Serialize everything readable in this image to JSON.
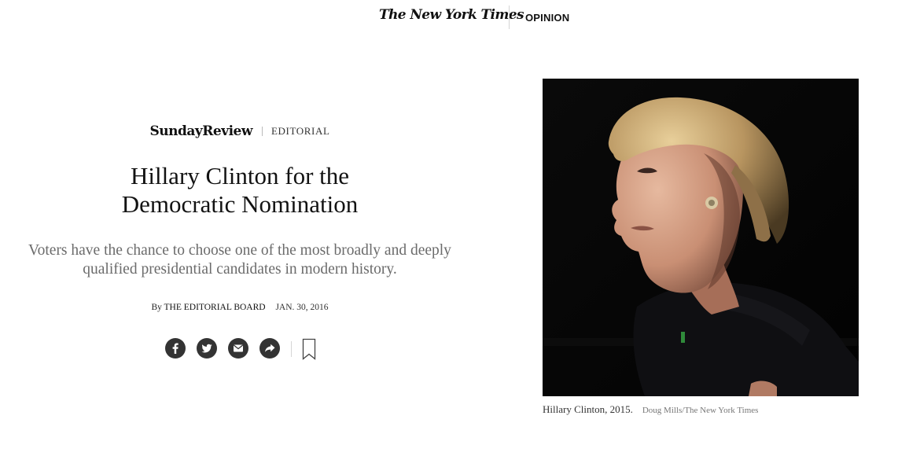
{
  "masthead": {
    "logo_text": "The New York Times",
    "section_label": "OPINION"
  },
  "kicker": {
    "brand": "SundayReview",
    "label": "EDITORIAL"
  },
  "article": {
    "headline": "Hillary Clinton for the Democratic Nomination",
    "summary": "Voters have the chance to choose one of the most broadly and deeply qualified presidential candidates in modern history.",
    "byline_prefix": "By",
    "author": "THE EDITORIAL BOARD",
    "date": "JAN. 30, 2016"
  },
  "share": {
    "buttons": [
      {
        "icon": "facebook-icon"
      },
      {
        "icon": "twitter-icon"
      },
      {
        "icon": "email-icon"
      },
      {
        "icon": "share-arrow-icon"
      }
    ],
    "save_icon": "bookmark-icon"
  },
  "photo": {
    "caption": "Hillary Clinton, 2015.",
    "credit": "Doug Mills/The New York Times"
  },
  "colors": {
    "text": "#121212",
    "summary": "#6b6b6b",
    "share_button": "#333333",
    "divider": "#d5d5d5",
    "photo_background": "#050505"
  }
}
